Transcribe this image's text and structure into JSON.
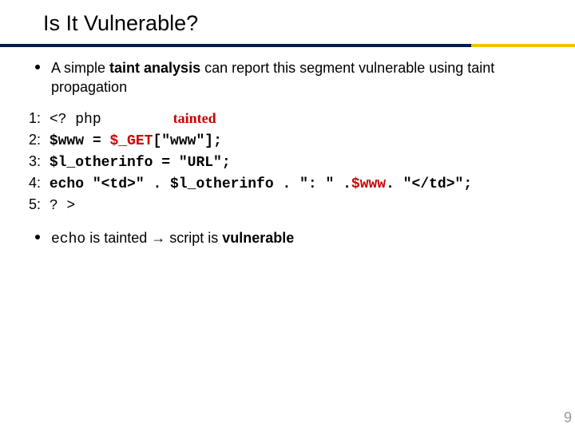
{
  "title": "Is It Vulnerable?",
  "bullets": {
    "b1_pre": "A simple ",
    "b1_bold": "taint analysis",
    "b1_post": " can report this segment vulnerable using taint propagation",
    "b2_code": "echo",
    "b2_mid": " is tainted → script is ",
    "b2_bold": "vulnerable"
  },
  "code": {
    "tainted_label": "tainted",
    "l1_a": "1:",
    "l1_b": " <? php",
    "l2_a": "2:",
    "l2_b": " $www = ",
    "l2_get": "$_GET",
    "l2_c": "[\"www\"];",
    "l3_a": "3:",
    "l3_b": " $l_otherinfo = \"URL\";",
    "l4_a": "4:",
    "l4_b": " echo \"<td>\" . $l_otherinfo . \": \" .",
    "l4_taint": "$www",
    "l4_c": ". \"</td>\";",
    "l5_a": "5:",
    "l5_b": " ? >"
  },
  "page_number": "9"
}
